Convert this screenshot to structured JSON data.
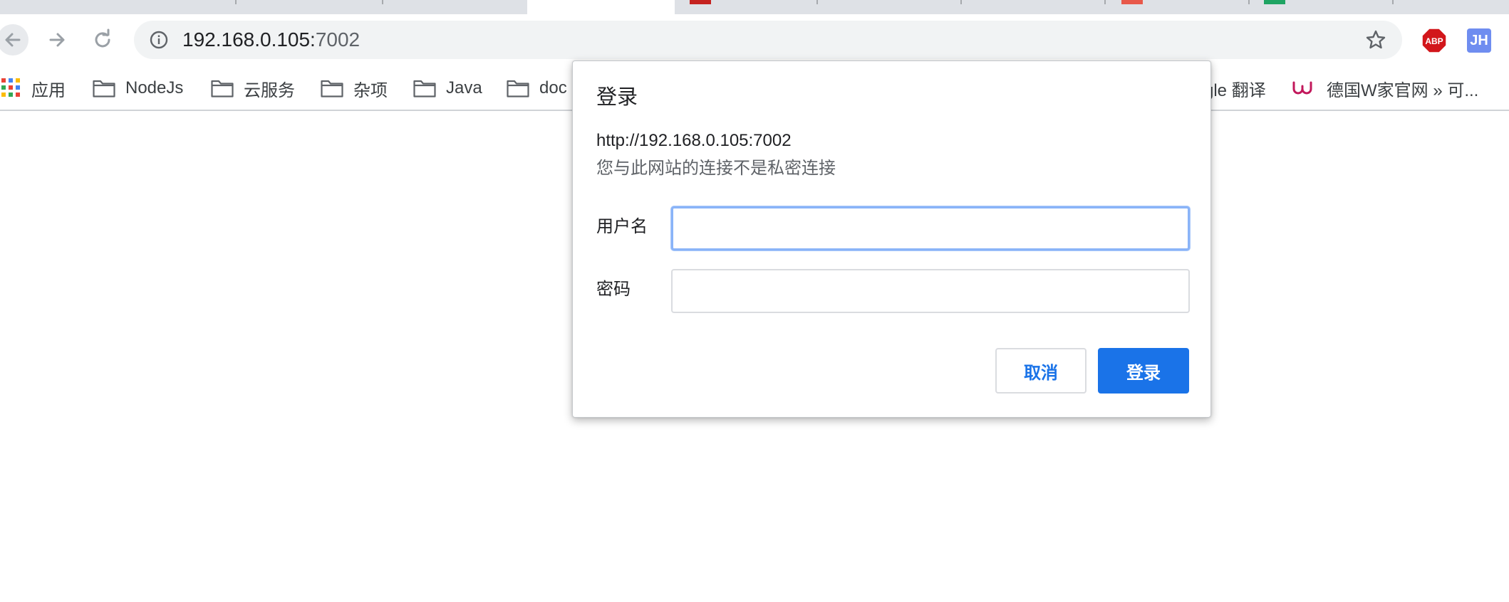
{
  "browser": {
    "address_bar": {
      "url_host": "192.168.0.105:",
      "url_port": "7002"
    },
    "extensions": {
      "abp_label": "ABP",
      "jh_label": "JH"
    }
  },
  "bookmarks": {
    "apps_label": "应用",
    "items": [
      {
        "label": "NodeJs"
      },
      {
        "label": "云服务"
      },
      {
        "label": "杂项"
      },
      {
        "label": "Java"
      },
      {
        "label": "doc"
      },
      {
        "label": "gle 翻译"
      },
      {
        "label": "德国W家官网 » 可..."
      }
    ]
  },
  "dialog": {
    "title": "登录",
    "origin": "http://192.168.0.105:7002",
    "warning": "您与此网站的连接不是私密连接",
    "username_label": "用户名",
    "username_value": "",
    "password_label": "密码",
    "password_value": "",
    "cancel_label": "取消",
    "login_label": "登录"
  },
  "colors": {
    "accent": "#1a73e8",
    "focus_ring": "#8ab4f8",
    "abp_red": "#d2161b",
    "jh_blue": "#6f8df0"
  }
}
